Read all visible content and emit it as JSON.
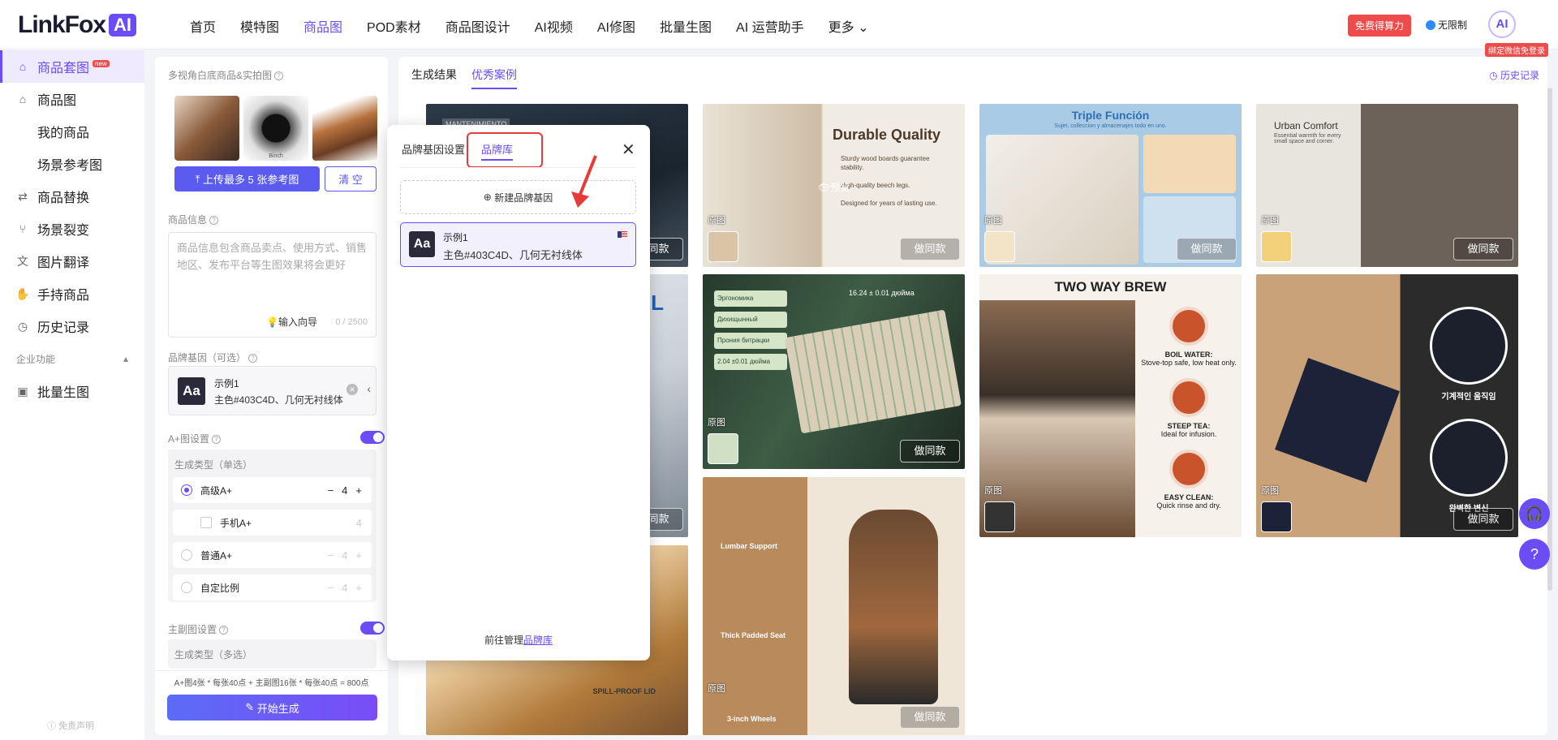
{
  "header": {
    "logo_text": "LinkFox",
    "logo_badge": "AI",
    "nav": [
      "首页",
      "模特图",
      "商品图",
      "POD素材",
      "商品图设计",
      "AI视频",
      "AI修图",
      "批量生图",
      "AI 运营助手",
      "更多"
    ],
    "active_nav": "商品图",
    "free_compute_label": "免费得算力",
    "unlimited_label": "无限制",
    "avatar_text": "AI",
    "bind_tip": "绑定微信免登录"
  },
  "sidebar": {
    "items": [
      {
        "label": "商品套图",
        "icon": "bag-icon",
        "active": true,
        "badge": "new"
      },
      {
        "label": "商品图",
        "icon": "bag-icon"
      },
      {
        "label": "我的商品",
        "sub": true
      },
      {
        "label": "场景参考图",
        "sub": true
      },
      {
        "label": "商品替换",
        "icon": "replace-icon"
      },
      {
        "label": "场景裂变",
        "icon": "split-icon"
      },
      {
        "label": "图片翻译",
        "icon": "translate-icon"
      },
      {
        "label": "手持商品",
        "icon": "hand-icon"
      },
      {
        "label": "历史记录",
        "icon": "clock-icon"
      }
    ],
    "group_label": "企业功能",
    "group_items": [
      {
        "label": "批量生图",
        "icon": "image-icon"
      }
    ],
    "footer": "免责声明"
  },
  "panel": {
    "upload_label": "多视角白底商品&实拍图",
    "thumb_caption": "Binch",
    "upload_button": "上传最多 5 张参考图",
    "clear_button": "清 空",
    "info_label": "商品信息",
    "info_placeholder": "商品信息包含商品卖点、使用方式、销售地区、发布平台等生图效果将会更好",
    "input_guide": "输入向导",
    "char_count": "0 / 2500",
    "brand_label": "品牌基因（可选）",
    "brand_name": "示例1",
    "brand_desc": "主色#403C4D、几何无衬线体",
    "aplus_label": "A+图设置",
    "gen_type_single": "生成类型（单选）",
    "options": [
      {
        "label": "高级A+",
        "count": "4",
        "selected": true
      },
      {
        "label": "手机A+",
        "count": "4",
        "checkbox": true
      },
      {
        "label": "普通A+",
        "count": "4"
      },
      {
        "label": "自定比例",
        "count": "4"
      }
    ],
    "main_img_label": "主副图设置",
    "gen_type_multi": "生成类型（多选）",
    "cost_text": "A+图4张 * 每张40点 + 主副图16张 * 每张40点 = 800点",
    "generate_button": "开始生成"
  },
  "main": {
    "tabs": [
      "生成结果",
      "优秀案例"
    ],
    "active_tab": "优秀案例",
    "history_link": "历史记录",
    "original_label": "原图",
    "same_style_label": "做同款",
    "preview_label": "预览",
    "cards": {
      "c1_tag": "MANTENIMIENTO",
      "c2_title": "Durable Quality",
      "c2_points": [
        "Sturdy wood boards guarantee stability.",
        "High-quality beech legs.",
        "Designed for years of lasting use."
      ],
      "c3_title": "Triple Función",
      "c3_sub": "Sujet, colleccion y almacenajes todo en uno.",
      "c4_title": "Urban Comfort",
      "c4_sub": "Essential warmth for every small space and corner.",
      "c5_dims": "16.24 ± 0.01 дюйма",
      "c5_features": [
        "Эргономика",
        "Дихищынный",
        "Прония битрацки",
        "2.04 ±0.01 дюйма"
      ],
      "c6_title": "TWO WAY BREW",
      "c6_steps": [
        {
          "title": "BOIL WATER:",
          "desc": "Stove-top safe, low heat only."
        },
        {
          "title": "STEEP TEA:",
          "desc": "Ideal for infusion."
        },
        {
          "title": "EASY CLEAN:",
          "desc": "Quick rinse and dry."
        }
      ],
      "c7_top": "기계적인 움직임",
      "c7_bottom": "완벽한 변신",
      "c8_features": [
        "Lumbar Support",
        "Thick Padded Seat",
        "3-inch Wheels"
      ],
      "c9_label": "SPILL-PROOF LID",
      "c10_label": "EL"
    }
  },
  "modal": {
    "tabs": [
      "品牌基因设置",
      "品牌库"
    ],
    "active_tab": "品牌库",
    "new_button": "新建品牌基因",
    "selected_name": "示例1",
    "selected_desc": "主色#403C4D、几何无衬线体",
    "manage_prefix": "前往管理",
    "manage_link": "品牌库"
  },
  "colors": {
    "accent": "#6B4CF6",
    "danger": "#EF4B4B",
    "brand_dark": "#403C4D"
  }
}
